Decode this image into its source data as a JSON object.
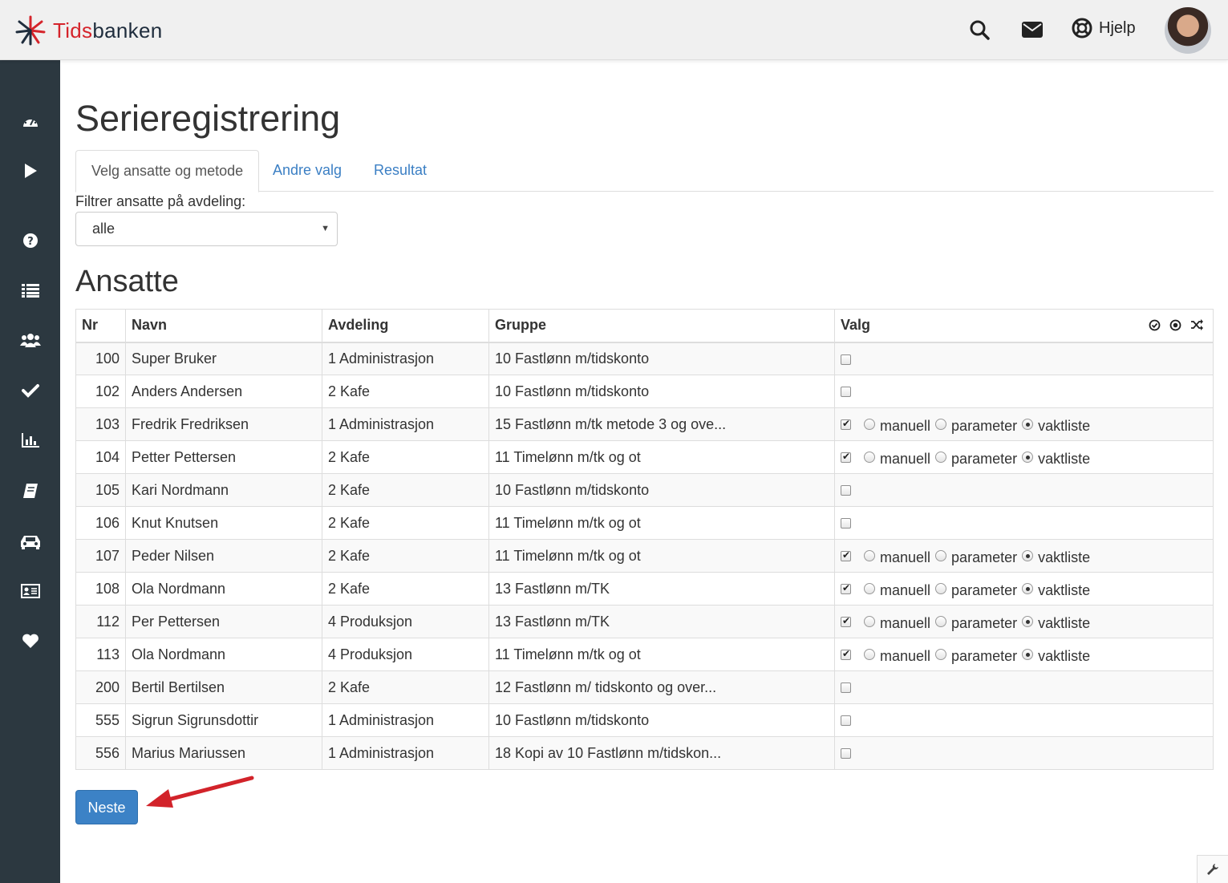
{
  "brand": {
    "name_part1": "Tids",
    "name_part2": "banken",
    "red": "#d5242b",
    "dark": "#1f2d3d"
  },
  "topbar": {
    "icons": [
      "search-icon",
      "envelope-icon",
      "lifebuoy-icon"
    ],
    "help_label": "Hjelp"
  },
  "sidebar": {
    "items": [
      "dashboard-icon",
      "play-icon",
      "question-icon",
      "list-icon",
      "users-icon",
      "check-icon",
      "bar-chart-icon",
      "book-icon",
      "car-icon",
      "id-card-icon",
      "heart-icon"
    ],
    "background": "#2c3840"
  },
  "page": {
    "title": "Serieregistrering"
  },
  "tabs": [
    {
      "label": "Velg ansatte og metode",
      "active": true
    },
    {
      "label": "Andre valg",
      "active": false
    },
    {
      "label": "Resultat",
      "active": false
    }
  ],
  "filter": {
    "label": "Filtrer ansatte på avdeling:",
    "value": "alle"
  },
  "section": {
    "title": "Ansatte"
  },
  "table": {
    "headers": {
      "nr": "Nr",
      "navn": "Navn",
      "avdeling": "Avdeling",
      "gruppe": "Gruppe",
      "valg": "Valg"
    },
    "radio_labels": {
      "manuell": "manuell",
      "parameter": "parameter",
      "vaktliste": "vaktliste"
    },
    "rows": [
      {
        "nr": "100",
        "navn": "Super Bruker",
        "avdeling": "1 Administrasjon",
        "gruppe": "10 Fastlønn m/tidskonto",
        "checked": false
      },
      {
        "nr": "102",
        "navn": "Anders Andersen",
        "avdeling": "2 Kafe",
        "gruppe": "10 Fastlønn m/tidskonto",
        "checked": false
      },
      {
        "nr": "103",
        "navn": "Fredrik Fredriksen",
        "avdeling": "1 Administrasjon",
        "gruppe": "15 Fastlønn m/tk metode 3 og ove...",
        "checked": true,
        "method": "vaktliste"
      },
      {
        "nr": "104",
        "navn": "Petter Pettersen",
        "avdeling": "2 Kafe",
        "gruppe": "11 Timelønn m/tk og ot",
        "checked": true,
        "method": "vaktliste"
      },
      {
        "nr": "105",
        "navn": "Kari Nordmann",
        "avdeling": "2 Kafe",
        "gruppe": "10 Fastlønn m/tidskonto",
        "checked": false
      },
      {
        "nr": "106",
        "navn": "Knut Knutsen",
        "avdeling": "2 Kafe",
        "gruppe": "11 Timelønn m/tk og ot",
        "checked": false
      },
      {
        "nr": "107",
        "navn": "Peder Nilsen",
        "avdeling": "2 Kafe",
        "gruppe": "11 Timelønn m/tk og ot",
        "checked": true,
        "method": "vaktliste"
      },
      {
        "nr": "108",
        "navn": "Ola Nordmann",
        "avdeling": "2 Kafe",
        "gruppe": "13 Fastlønn m/TK",
        "checked": true,
        "method": "vaktliste"
      },
      {
        "nr": "112",
        "navn": "Per Pettersen",
        "avdeling": "4 Produksjon",
        "gruppe": "13 Fastlønn m/TK",
        "checked": true,
        "method": "vaktliste"
      },
      {
        "nr": "113",
        "navn": "Ola Nordmann",
        "avdeling": "4 Produksjon",
        "gruppe": "11 Timelønn m/tk og ot",
        "checked": true,
        "method": "vaktliste"
      },
      {
        "nr": "200",
        "navn": "Bertil Bertilsen",
        "avdeling": "2 Kafe",
        "gruppe": "12 Fastlønn m/ tidskonto og over...",
        "checked": false
      },
      {
        "nr": "555",
        "navn": "Sigrun Sigrunsdottir",
        "avdeling": "1 Administrasjon",
        "gruppe": "10 Fastlønn m/tidskonto",
        "checked": false
      },
      {
        "nr": "556",
        "navn": "Marius Mariussen",
        "avdeling": "1 Administrasjon",
        "gruppe": "18 Kopi av 10 Fastlønn m/tidskon...",
        "checked": false
      }
    ]
  },
  "actions": {
    "next_label": "Neste",
    "button_color": "#3c82c6",
    "arrow_color": "#d2232a"
  }
}
